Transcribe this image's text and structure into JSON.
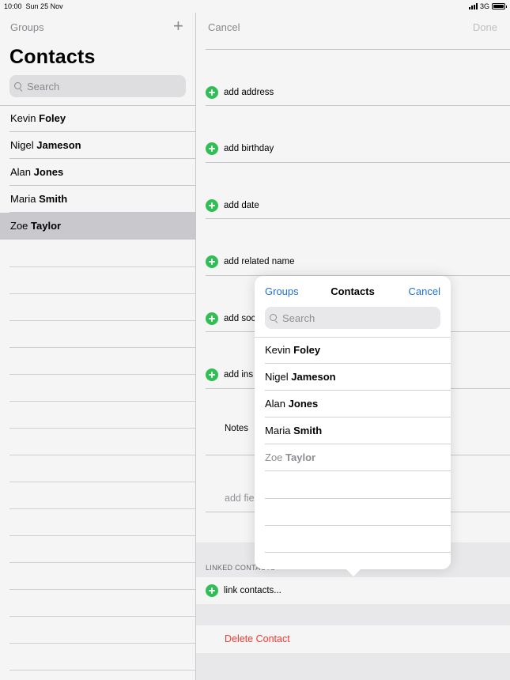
{
  "status_bar": {
    "time": "10:00",
    "date": "Sun 25 Nov",
    "network": "3G"
  },
  "left": {
    "groups_label": "Groups",
    "add_label": "+",
    "title": "Contacts",
    "search_placeholder": "Search",
    "contacts": [
      {
        "first": "Kevin",
        "last": "Foley"
      },
      {
        "first": "Nigel",
        "last": "Jameson"
      },
      {
        "first": "Alan",
        "last": "Jones"
      },
      {
        "first": "Maria",
        "last": "Smith"
      },
      {
        "first": "Zoe",
        "last": "Taylor"
      }
    ]
  },
  "right": {
    "cancel_label": "Cancel",
    "done_label": "Done",
    "fields": [
      "add address",
      "add birthday",
      "add date",
      "add related name",
      "add soc",
      "add ins"
    ],
    "notes_label": "Notes",
    "add_field_label": "add fie",
    "linked_contacts_header": "LINKED CONTACTS",
    "link_contacts_label": "link contacts...",
    "delete_label": "Delete Contact"
  },
  "popover": {
    "groups_label": "Groups",
    "title": "Contacts",
    "cancel_label": "Cancel",
    "search_placeholder": "Search",
    "contacts": [
      {
        "first": "Kevin",
        "last": "Foley"
      },
      {
        "first": "Nigel",
        "last": "Jameson"
      },
      {
        "first": "Alan",
        "last": "Jones"
      },
      {
        "first": "Maria",
        "last": "Smith"
      },
      {
        "first": "Zoe",
        "last": "Taylor"
      }
    ]
  },
  "colors": {
    "accent": "#1f6fd6",
    "add_green": "#34c759",
    "destructive": "#ff3b30",
    "selected_row": "#d1d1d6"
  }
}
